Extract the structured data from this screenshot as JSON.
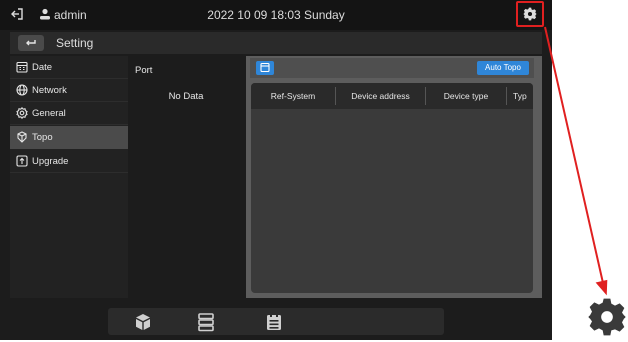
{
  "header": {
    "user": "admin",
    "datetime": "2022 10 09 18:03 Sunday"
  },
  "settingbar": {
    "title": "Setting"
  },
  "sidebar": {
    "items": [
      {
        "label": "Date",
        "icon": "calendar-icon"
      },
      {
        "label": "Network",
        "icon": "globe-icon"
      },
      {
        "label": "General",
        "icon": "gear-outline-icon"
      },
      {
        "label": "Topo",
        "icon": "topology-icon",
        "active": true
      },
      {
        "label": "Upgrade",
        "icon": "upgrade-icon"
      }
    ]
  },
  "port": {
    "label": "Port",
    "empty": "No Data"
  },
  "topo": {
    "auto_button": "Auto Topo",
    "columns": [
      "Ref-System",
      "Device address",
      "Device type",
      "Typ"
    ]
  },
  "bottom": {
    "icons": [
      "cube-icon",
      "server-icon",
      "calendar-list-icon"
    ]
  },
  "colors": {
    "accent": "#2f86d8",
    "highlight": "#e02020"
  }
}
